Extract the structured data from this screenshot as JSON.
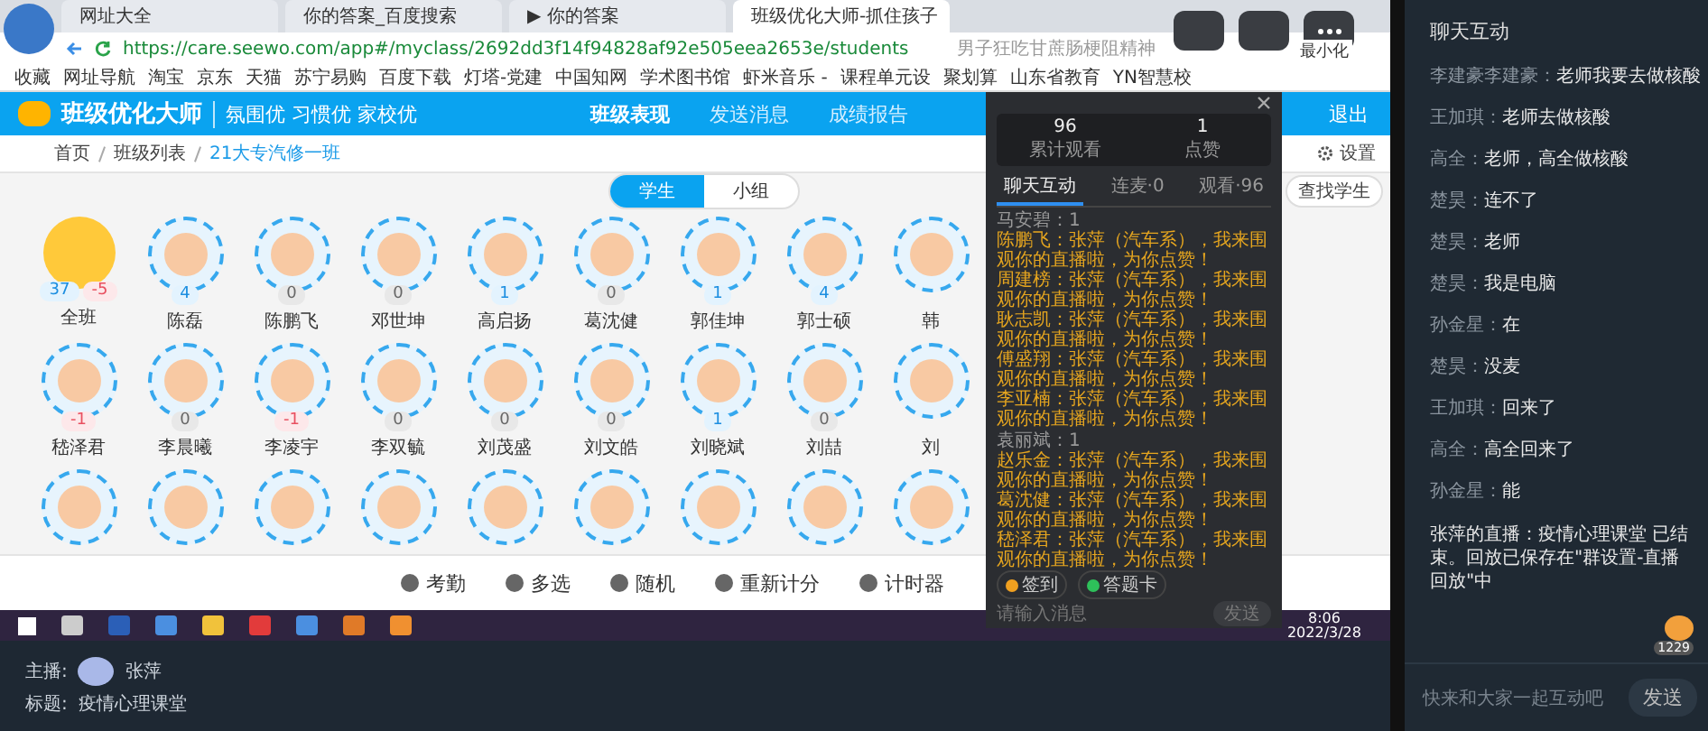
{
  "browser": {
    "tabs": [
      {
        "label": "网址大全",
        "selected": false
      },
      {
        "label": "你的答案_百度搜索",
        "selected": false
      },
      {
        "label": "▶ 你的答案",
        "selected": false
      },
      {
        "label": "班级优化大师-抓住孩子",
        "selected": true
      }
    ],
    "url": "https://care.seewo.com/app#/myclass/2692dd3f14f94828af92e505eea2653e/students",
    "search_hint": "男子狂吃甘蔗肠梗阻精神",
    "tooltip": "最小化",
    "bookmarks": [
      "收藏",
      "网址导航",
      "淘宝",
      "京东",
      "天猫",
      "苏宁易购",
      "百度下载",
      "灯塔-党建",
      "中国知网",
      "学术图书馆",
      "虾米音乐 -",
      "课程单元设",
      "聚划算",
      "山东省教育",
      "YN智慧校"
    ]
  },
  "app": {
    "brand": "班级优化大师",
    "slogan": "氛围优 习惯优 家校优",
    "nav": [
      {
        "label": "班级表现",
        "selected": true
      },
      {
        "label": "发送消息",
        "selected": false
      },
      {
        "label": "成绩报告",
        "selected": false
      }
    ],
    "logout": "退出",
    "settings": "设置",
    "find_student": "查找学生",
    "breadcrumb": [
      "首页",
      "班级列表",
      "21大专汽修一班"
    ],
    "views": [
      {
        "label": "学生",
        "selected": true
      },
      {
        "label": "小组",
        "selected": false
      }
    ],
    "students": [
      {
        "kind": "class",
        "name": "全班",
        "scores": [
          "37",
          "-5"
        ]
      },
      {
        "kind": "student",
        "name": "陈磊",
        "score": "4",
        "negative": false,
        "dimmed": false
      },
      {
        "kind": "student",
        "name": "陈鹏飞",
        "score": "0",
        "negative": false,
        "dimmed": true
      },
      {
        "kind": "student",
        "name": "邓世坤",
        "score": "0",
        "negative": false,
        "dimmed": true
      },
      {
        "kind": "student",
        "name": "高启扬",
        "score": "1",
        "negative": false,
        "dimmed": false
      },
      {
        "kind": "student",
        "name": "葛沈健",
        "score": "0",
        "negative": false,
        "dimmed": true
      },
      {
        "kind": "student",
        "name": "郭佳坤",
        "score": "1",
        "negative": false,
        "dimmed": false
      },
      {
        "kind": "student",
        "name": "郭士硕",
        "score": "4",
        "negative": false,
        "dimmed": false
      },
      {
        "kind": "student",
        "name": "韩"
      },
      {
        "kind": "student",
        "name": "嵇泽君",
        "score": "-1",
        "negative": true,
        "dimmed": false
      },
      {
        "kind": "student",
        "name": "李晨曦",
        "score": "0",
        "negative": false,
        "dimmed": true
      },
      {
        "kind": "student",
        "name": "李凌宇",
        "score": "-1",
        "negative": true,
        "dimmed": false
      },
      {
        "kind": "student",
        "name": "李双毓",
        "score": "0",
        "negative": false,
        "dimmed": true
      },
      {
        "kind": "student",
        "name": "刘茂盛",
        "score": "0",
        "negative": false,
        "dimmed": true
      },
      {
        "kind": "student",
        "name": "刘文皓",
        "score": "0",
        "negative": false,
        "dimmed": true
      },
      {
        "kind": "student",
        "name": "刘晓斌",
        "score": "1",
        "negative": false,
        "dimmed": false
      },
      {
        "kind": "student",
        "name": "刘喆",
        "score": "0",
        "negative": false,
        "dimmed": true
      },
      {
        "kind": "student",
        "name": "刘"
      },
      {
        "kind": "partial"
      },
      {
        "kind": "partial"
      },
      {
        "kind": "partial"
      },
      {
        "kind": "partial"
      },
      {
        "kind": "partial"
      },
      {
        "kind": "partial"
      },
      {
        "kind": "partial"
      },
      {
        "kind": "partial"
      },
      {
        "kind": "partial"
      }
    ],
    "toolbar": [
      "考勤",
      "多选",
      "随机",
      "重新计分",
      "计时器"
    ]
  },
  "taskbar": {
    "time": "8:06",
    "date": "2022/3/28"
  },
  "live_panel": {
    "stats": [
      {
        "value": "96",
        "label": "累计观看"
      },
      {
        "value": "1",
        "label": "点赞"
      }
    ],
    "tabs": [
      {
        "label": "聊天互动",
        "selected": true
      },
      {
        "label": "连麦·0",
        "selected": false
      },
      {
        "label": "观看·96",
        "selected": false
      }
    ],
    "messages": [
      {
        "kind": "count",
        "name": "马安碧：",
        "text": "1"
      },
      {
        "kind": "like",
        "name": "陈鹏飞：",
        "text": "张萍（汽车系），我来围观你的直播啦，为你点赞！"
      },
      {
        "kind": "like",
        "name": "周建榜：",
        "text": "张萍（汽车系），我来围观你的直播啦，为你点赞！"
      },
      {
        "kind": "like",
        "name": "耿志凯：",
        "text": "张萍（汽车系），我来围观你的直播啦，为你点赞！"
      },
      {
        "kind": "like",
        "name": "傅盛翔：",
        "text": "张萍（汽车系），我来围观你的直播啦，为你点赞！"
      },
      {
        "kind": "like",
        "name": "李亚楠：",
        "text": "张萍（汽车系），我来围观你的直播啦，为你点赞！"
      },
      {
        "kind": "count",
        "name": "袁丽斌：",
        "text": "1"
      },
      {
        "kind": "like",
        "name": "赵乐金：",
        "text": "张萍（汽车系），我来围观你的直播啦，为你点赞！"
      },
      {
        "kind": "like",
        "name": "葛沈健：",
        "text": "张萍（汽车系），我来围观你的直播啦，为你点赞！"
      },
      {
        "kind": "like",
        "name": "嵇泽君：",
        "text": "张萍（汽车系），我来围观你的直播啦，为你点赞！"
      }
    ],
    "actions": [
      "签到",
      "答题卡"
    ],
    "placeholder": "请输入消息",
    "send": "发送"
  },
  "host": {
    "host_label": "主播:",
    "host_name": "张萍",
    "title_label": "标题:",
    "title": "疫情心理课堂"
  },
  "chat": {
    "title": "聊天互动",
    "messages": [
      {
        "kind": "message",
        "name": "李建豪李建豪：",
        "text": "老师我要去做核酸"
      },
      {
        "kind": "message",
        "name": "王加琪：",
        "text": "老师去做核酸"
      },
      {
        "kind": "message",
        "name": "高全：",
        "text": "老师，高全做核酸"
      },
      {
        "kind": "message",
        "name": "楚昊：",
        "text": "连不了"
      },
      {
        "kind": "message",
        "name": "楚昊：",
        "text": "老师"
      },
      {
        "kind": "message",
        "name": "楚昊：",
        "text": "我是电脑"
      },
      {
        "kind": "message",
        "name": "孙金星：",
        "text": "在"
      },
      {
        "kind": "message",
        "name": "楚昊：",
        "text": "没麦"
      },
      {
        "kind": "message",
        "name": "王加琪：",
        "text": "回来了"
      },
      {
        "kind": "message",
        "name": "高全：",
        "text": "高全回来了"
      },
      {
        "kind": "message",
        "name": "孙金星：",
        "text": "能"
      },
      {
        "kind": "system",
        "text": "张萍的直播：疫情心理课堂 已结束。回放已保存在\"群设置-直播回放\"中"
      }
    ],
    "likes": "1229",
    "placeholder": "快来和大家一起互动吧",
    "send": "发送"
  }
}
